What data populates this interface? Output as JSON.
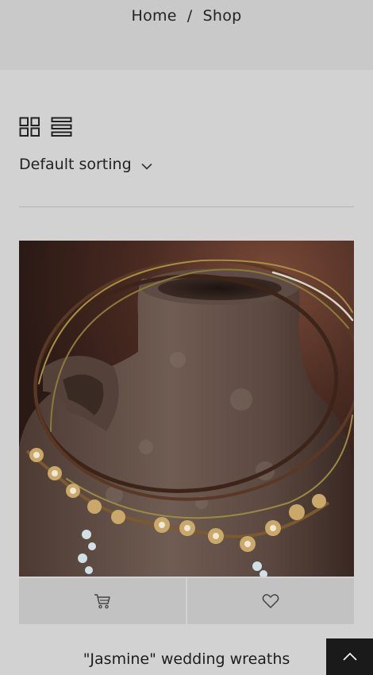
{
  "breadcrumb": {
    "home": "Home",
    "separator": "/",
    "current": "Shop"
  },
  "view_toggles": {
    "grid_icon": "grid-view-icon",
    "list_icon": "list-view-icon"
  },
  "sorting": {
    "selected": "Default sorting",
    "icon": "chevron-down-icon"
  },
  "product": {
    "title": "\"Jasmine\" wedding wreaths",
    "image_icon": "product-photo",
    "add_to_cart_icon": "cart-icon",
    "wishlist_icon": "heart-icon"
  },
  "scroll_top": {
    "icon": "chevron-up-icon"
  },
  "colors": {
    "page_bg": "#d2d2d2",
    "header_bg": "#c9c9c9",
    "action_bg": "#c2c2c2",
    "scroll_top_bg": "#1a1a1a"
  }
}
